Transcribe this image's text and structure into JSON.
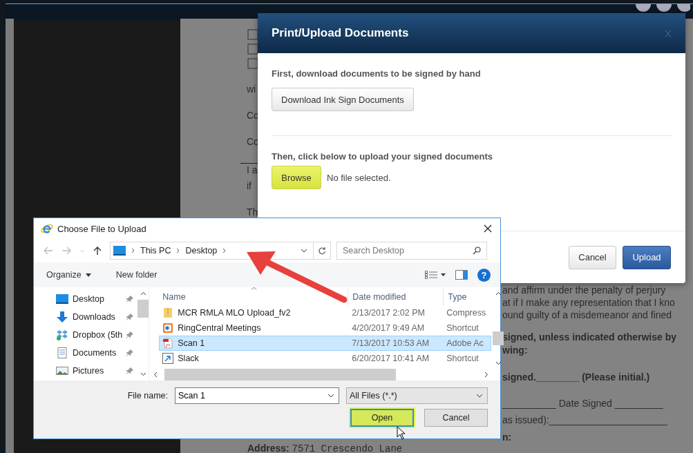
{
  "document": {
    "fragments": [
      {
        "text": "wi",
        "kind": "plain"
      },
      {
        "text": "Co",
        "kind": "plain"
      },
      {
        "text": "Co",
        "kind": "plain"
      },
      {
        "text": "I a",
        "kind": "plain"
      },
      {
        "text": "if",
        "kind": "plain"
      },
      {
        "text": "Th",
        "kind": "plain"
      },
      {
        "text": "and affirm under the penalty of perjury",
        "kind": "plain"
      },
      {
        "text": "at if I make any representation that I kno",
        "kind": "plain"
      },
      {
        "text": "ound guilty of a misdemeanor and fined",
        "kind": "plain"
      },
      {
        "text": "signed, unless indicated otherwise by",
        "kind": "bold"
      },
      {
        "text": "wing:",
        "kind": "bold"
      },
      {
        "text": "signed.________ (Please initial.)",
        "kind": "bold"
      },
      {
        "text": "__________ Date Signed _________",
        "kind": "plain"
      },
      {
        "text": "as issued):______________________",
        "kind": "plain"
      },
      {
        "text": "n:",
        "kind": "bold"
      },
      {
        "text": "Address: **7571 Crescendo Lane**",
        "kind": "address"
      }
    ]
  },
  "upload_modal": {
    "title": "Print/Upload Documents",
    "close": "X",
    "download_prompt": "First, download documents to be signed by hand",
    "download_button": "Download Ink Sign Documents",
    "upload_prompt": "Then, click below to upload your signed documents",
    "browse_button": "Browse",
    "file_status": "No file selected.",
    "buttons": [
      {
        "label": "Cancel",
        "kind": "default"
      },
      {
        "label": "Upload",
        "kind": "primary"
      }
    ]
  },
  "file_dialog": {
    "title": "Choose File to Upload",
    "address": [
      "This PC",
      "Desktop"
    ],
    "search": {
      "placeholder": "Search Desktop"
    },
    "toolbar": {
      "organize": "Organize",
      "new_folder": "New folder",
      "help": "?"
    },
    "sidebar": [
      {
        "label": "Desktop",
        "kind": "desktop"
      },
      {
        "label": "Downloads",
        "kind": "downloads"
      },
      {
        "label": "Dropbox (5th",
        "kind": "dropbox"
      },
      {
        "label": "Documents",
        "kind": "documents"
      },
      {
        "label": "Pictures",
        "kind": "pictures"
      }
    ],
    "columns": [
      "Name",
      "Date modified",
      "Type"
    ],
    "rows": [
      {
        "name": "MCR RMLA MLO Upload_fv2",
        "date": "2/13/2017 2:02 PM",
        "type": "Compress",
        "kind": "zip",
        "selected": false
      },
      {
        "name": "RingCentral Meetings",
        "date": "4/20/2017 9:49 AM",
        "type": "Shortcut",
        "kind": "app",
        "selected": false
      },
      {
        "name": "Scan 1",
        "date": "7/13/2017 10:53 AM",
        "type": "Adobe Ac",
        "kind": "pdf",
        "selected": true
      },
      {
        "name": "Slack",
        "date": "6/20/2017 10:41 AM",
        "type": "Shortcut",
        "kind": "shortcut",
        "selected": false
      }
    ],
    "file_name": {
      "label": "File name:",
      "value": "Scan 1"
    },
    "filter": {
      "value": "All Files (*.*)"
    },
    "buttons": [
      {
        "label": "Open",
        "highlighted": true
      },
      {
        "label": "Cancel",
        "highlighted": false
      }
    ]
  }
}
